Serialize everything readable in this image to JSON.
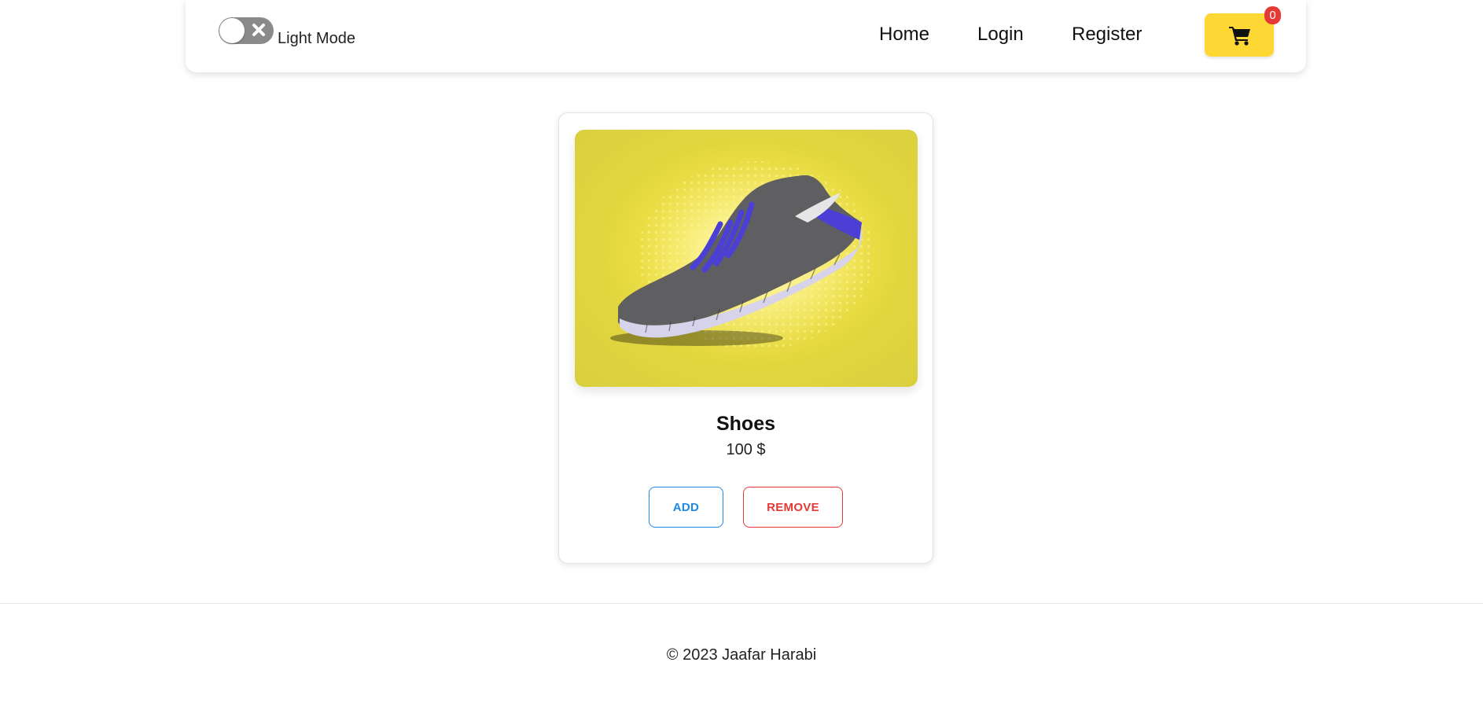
{
  "theme_toggle": {
    "label": "Light Mode",
    "enabled": false
  },
  "nav": {
    "links": [
      {
        "label": "Home"
      },
      {
        "label": "Login"
      },
      {
        "label": "Register"
      }
    ],
    "cart": {
      "icon": "shopping-cart-icon",
      "count": "0",
      "button_color": "#fdd835",
      "badge_color": "#e53935"
    }
  },
  "product": {
    "name": "Shoes",
    "price": "100 $",
    "image": "sneaker-product-image",
    "add_label": "ADD",
    "remove_label": "REMOVE",
    "add_color": "#1e88e5",
    "remove_color": "#e53935"
  },
  "footer": {
    "text": "© 2023 Jaafar Harabi"
  }
}
